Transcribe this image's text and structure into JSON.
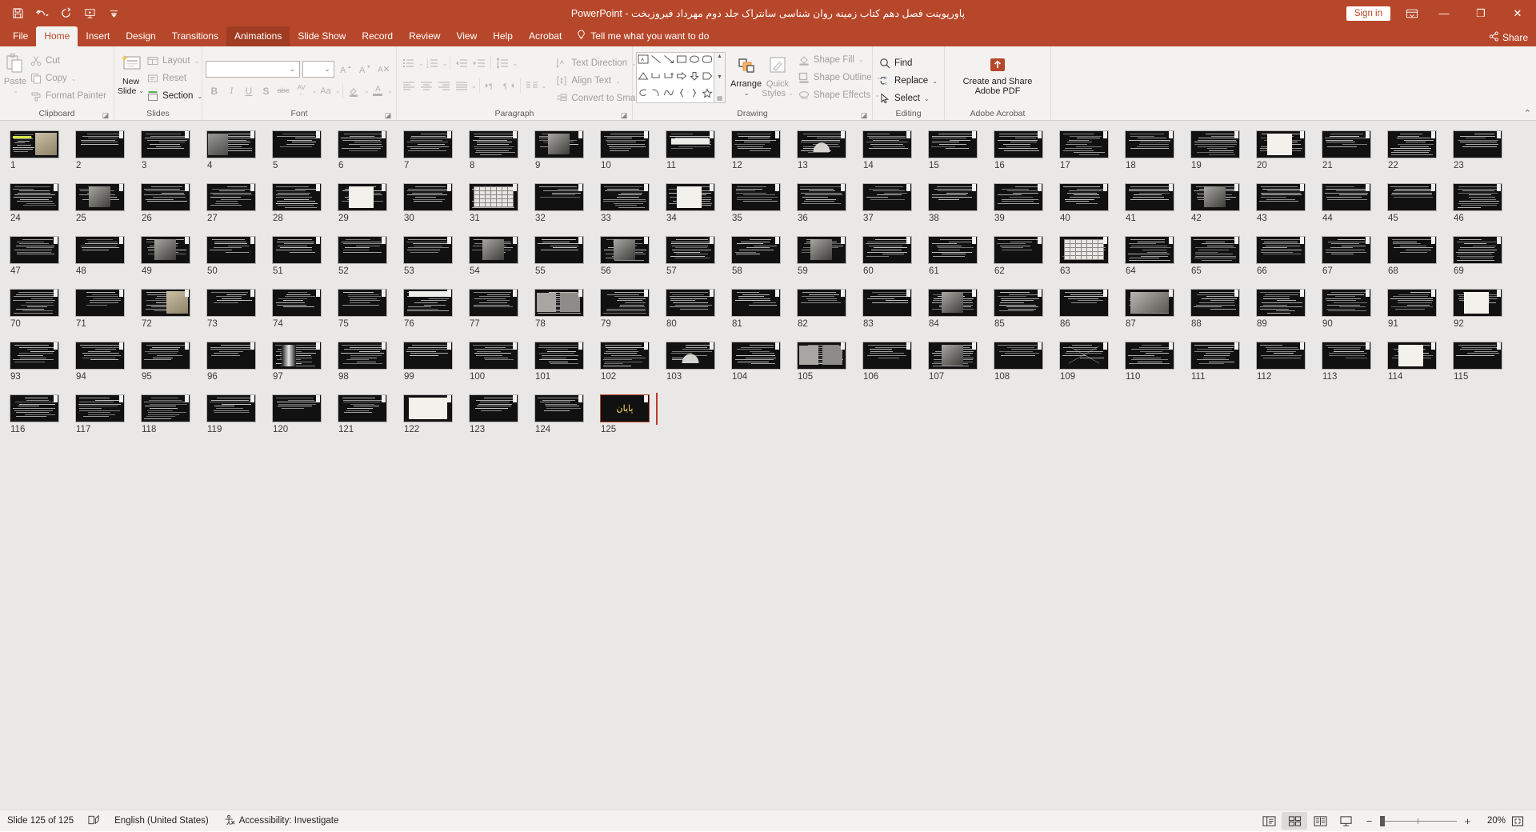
{
  "titlebar": {
    "document_title": "پاورپوینت فصل دهم کتاب زمینه روان شناسی سانتراک جلد دوم مهرداد فیروزبخت",
    "app_name": "PowerPoint",
    "separator": "-",
    "sign_in": "Sign in",
    "quick_access": [
      {
        "name": "save-icon",
        "label": "Save"
      },
      {
        "name": "undo-icon",
        "label": "Undo"
      },
      {
        "name": "redo-icon",
        "label": "Redo"
      },
      {
        "name": "start-presentation-icon",
        "label": "Start From Beginning"
      },
      {
        "name": "customize-qat-icon",
        "label": "Customize Quick Access Toolbar"
      }
    ],
    "window_controls": {
      "ribbon_display": "Ribbon Display Options",
      "minimize": "—",
      "restore": "❐",
      "close": "✕"
    }
  },
  "tabs": [
    {
      "label": "File",
      "state": "normal"
    },
    {
      "label": "Home",
      "state": "active"
    },
    {
      "label": "Insert",
      "state": "normal"
    },
    {
      "label": "Design",
      "state": "normal"
    },
    {
      "label": "Transitions",
      "state": "normal"
    },
    {
      "label": "Animations",
      "state": "hover"
    },
    {
      "label": "Slide Show",
      "state": "normal"
    },
    {
      "label": "Record",
      "state": "normal"
    },
    {
      "label": "Review",
      "state": "normal"
    },
    {
      "label": "View",
      "state": "normal"
    },
    {
      "label": "Help",
      "state": "normal"
    },
    {
      "label": "Acrobat",
      "state": "normal"
    }
  ],
  "tell_me": "Tell me what you want to do",
  "share": "Share",
  "ribbon": {
    "groups": [
      {
        "name": "clipboard",
        "title": "Clipboard"
      },
      {
        "name": "slides",
        "title": "Slides"
      },
      {
        "name": "font",
        "title": "Font"
      },
      {
        "name": "paragraph",
        "title": "Paragraph"
      },
      {
        "name": "drawing",
        "title": "Drawing"
      },
      {
        "name": "editing",
        "title": "Editing"
      },
      {
        "name": "adobe-acrobat",
        "title": "Adobe Acrobat"
      }
    ],
    "clipboard": {
      "paste": "Paste",
      "cut": "Cut",
      "copy": "Copy",
      "format_painter": "Format Painter"
    },
    "slides": {
      "new_slide": "New\nSlide",
      "new_slide_line1": "New",
      "new_slide_line2": "Slide",
      "layout": "Layout",
      "reset": "Reset",
      "section": "Section"
    },
    "font": {
      "font_name_value": "",
      "font_name_placeholder": "",
      "font_size_value": "",
      "bold": "B",
      "italic": "I",
      "underline": "U",
      "shadow": "S",
      "strikethrough": "abc",
      "char_spacing": "AV",
      "change_case": "Aa",
      "increase_font": "A",
      "decrease_font": "A",
      "clear_formatting": "Clear All Formatting",
      "text_highlight": "Text Highlight Color",
      "font_color": "A"
    },
    "paragraph": {
      "bullets": "Bullets",
      "numbering": "Numbering",
      "decrease_indent": "Decrease List Level",
      "increase_indent": "Increase List Level",
      "line_spacing": "Line Spacing",
      "align_left": "Align Left",
      "center": "Center",
      "align_right": "Align Right",
      "justify": "Justify",
      "ltr": "Left-to-Right Text Direction",
      "rtl": "Right-to-Left Text Direction",
      "columns": "Columns",
      "text_direction": "Text Direction",
      "align_text": "Align Text",
      "convert_to_smartart": "Convert to SmartArt"
    },
    "drawing": {
      "arrange": "Arrange",
      "quick_styles_line1": "Quick",
      "quick_styles_line2": "Styles",
      "shape_fill": "Shape Fill",
      "shape_outline": "Shape Outline",
      "shape_effects": "Shape Effects"
    },
    "editing": {
      "find": "Find",
      "replace": "Replace",
      "select": "Select"
    },
    "acrobat": {
      "create_and_share_line1": "Create and Share",
      "create_and_share_line2": "Adobe PDF"
    }
  },
  "slide_sorter": {
    "total_slides": 125,
    "selected_slide": 125,
    "columns": 18,
    "last_slide_text": "پایان",
    "special_slides": {
      "1": "title-with-photo",
      "4": "image-left",
      "9": "portrait-photo",
      "11": "text-box",
      "13": "bell-curve-chart",
      "19": "two-images",
      "20": "photo-panel",
      "25": "portrait-photo",
      "29": "document-pages",
      "31": "table-grid",
      "34": "photo-frame",
      "42": "illustration",
      "49": "portrait-photo",
      "54": "photo-dark",
      "56": "landscape-photo",
      "59": "framed-image",
      "63": "table-grid",
      "72": "photo-right",
      "76": "header-box",
      "78": "two-photos",
      "84": "grey-photo",
      "87": "group-photo",
      "92": "white-panel",
      "97": "x-ray-image",
      "103": "bell-curve-chart",
      "105": "photo-pair",
      "107": "photo-dark",
      "109": "pyramid-chart",
      "114": "document-page",
      "122": "wide-document"
    }
  },
  "statusbar": {
    "slide_indicator": "Slide 125 of 125",
    "notes_icon_label": "Notes",
    "language": "English (United States)",
    "accessibility": "Accessibility: Investigate",
    "views": [
      {
        "name": "normal-view",
        "label": "Normal",
        "active": false
      },
      {
        "name": "slide-sorter-view",
        "label": "Slide Sorter",
        "active": true
      },
      {
        "name": "reading-view",
        "label": "Reading View",
        "active": false
      },
      {
        "name": "slide-show-view",
        "label": "Slide Show",
        "active": false
      }
    ],
    "zoom_out": "−",
    "zoom_in": "+",
    "zoom_level": "20%",
    "fit_to_window": "Fit slide to current window"
  },
  "colors": {
    "accent": "#b7472a",
    "accent_dark": "#a03c22",
    "ribbon_bg": "#f3f2f1",
    "sorter_bg": "#e9e8e7",
    "selection": "#b7472a"
  }
}
